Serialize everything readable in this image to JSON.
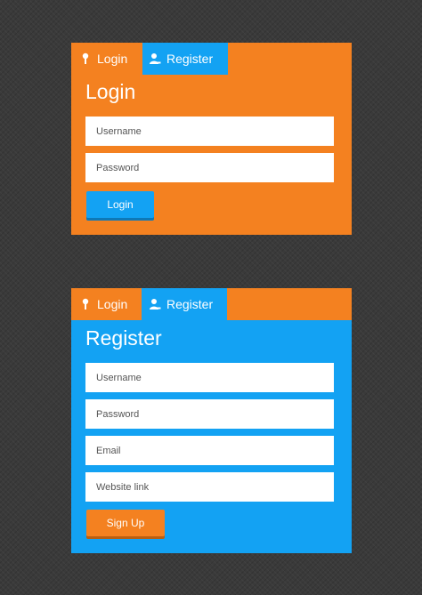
{
  "colors": {
    "orange": "#f48120",
    "blue": "#13a2f3",
    "login_btn_shadow": "#0d79b8",
    "signup_btn_shadow": "#b85f12"
  },
  "login_panel": {
    "tabs": [
      {
        "label": "Login",
        "icon": "key-icon"
      },
      {
        "label": "Register",
        "icon": "user-icon"
      }
    ],
    "title": "Login",
    "fields": [
      {
        "placeholder": "Username",
        "value": ""
      },
      {
        "placeholder": "Password",
        "value": ""
      }
    ],
    "button_label": "Login"
  },
  "register_panel": {
    "tabs": [
      {
        "label": "Login",
        "icon": "key-icon"
      },
      {
        "label": "Register",
        "icon": "user-icon"
      }
    ],
    "title": "Register",
    "fields": [
      {
        "placeholder": "Username",
        "value": ""
      },
      {
        "placeholder": "Password",
        "value": ""
      },
      {
        "placeholder": "Email",
        "value": ""
      },
      {
        "placeholder": "Website link",
        "value": ""
      }
    ],
    "button_label": "Sign Up"
  }
}
